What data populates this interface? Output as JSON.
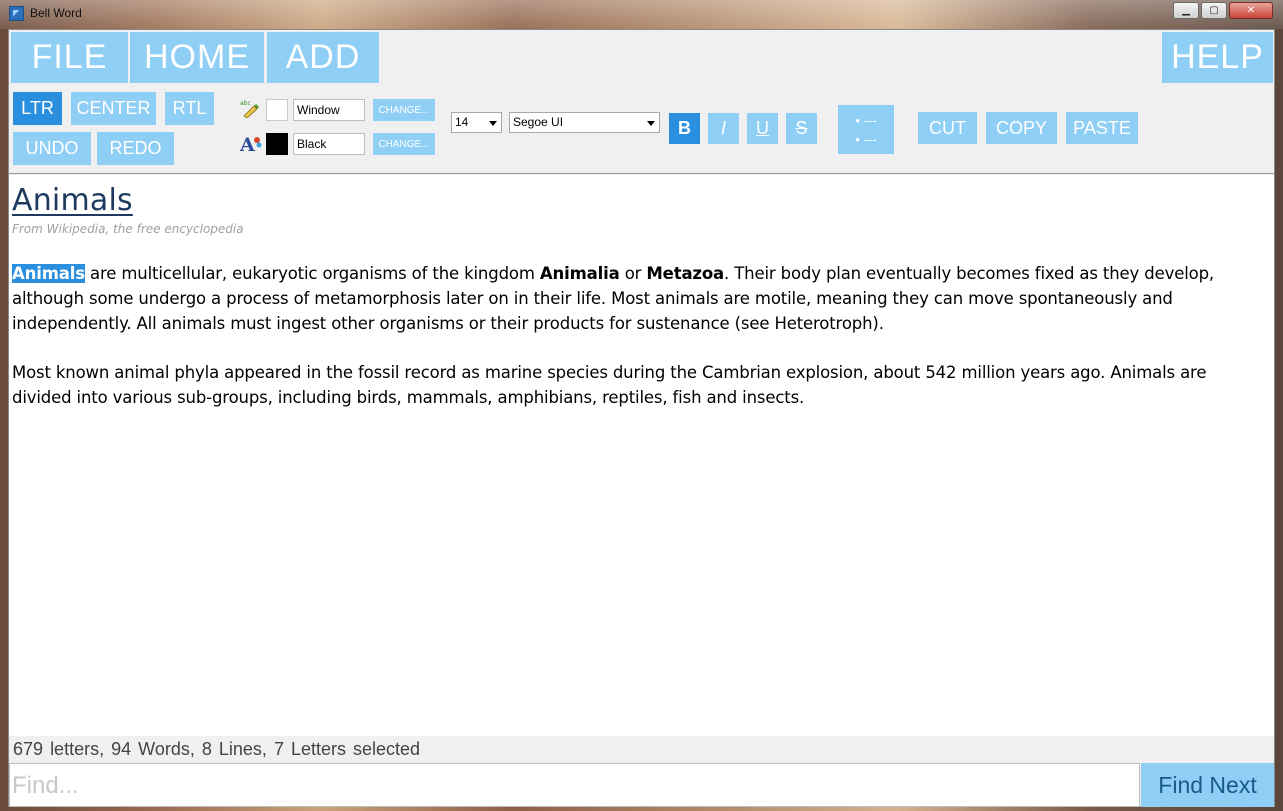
{
  "window": {
    "title": "Bell Word",
    "controls": [
      "minimize",
      "maximize",
      "close"
    ]
  },
  "tabs": {
    "file": "FILE",
    "home": "HOME",
    "add": "ADD",
    "help": "HELP"
  },
  "alignment": {
    "ltr": "LTR",
    "center": "CENTER",
    "rtl": "RTL",
    "active": "LTR"
  },
  "history": {
    "undo": "UNDO",
    "redo": "REDO"
  },
  "highlight": {
    "icon": "highlighter-icon",
    "color_name": "Window",
    "swatch_color": "#ffffff",
    "change": "CHANGE..."
  },
  "fontcolor": {
    "icon": "font-color-icon",
    "color_name": "Black",
    "swatch_color": "#000000",
    "change": "CHANGE..."
  },
  "font": {
    "size": "14",
    "family": "Segoe UI"
  },
  "format": {
    "bold": "B",
    "italic": "I",
    "underline": "U",
    "strike": "S",
    "active": "bold"
  },
  "list": {
    "item1": "• ---",
    "item2": "• ---"
  },
  "clipboard": {
    "cut": "CUT",
    "copy": "COPY",
    "paste": "PASTE"
  },
  "document": {
    "title": "Animals",
    "subtitle": "From Wikipedia, the free encyclopedia",
    "p1": {
      "selected": "Animals",
      "t1": " are multicellular, eukaryotic organisms of the kingdom ",
      "b1": "Animalia",
      "t2": " or ",
      "b2": "Metazoa",
      "t3": ". Their body plan eventually becomes fixed as they develop, although some undergo a process of metamorphosis later on in their life. Most animals are motile, meaning they can move spontaneously and independently. All animals must ingest other organisms or their products for sustenance (see Heterotroph)."
    },
    "p2": "Most known animal phyla appeared in the fossil record as marine species during the Cambrian explosion, about 542 million years ago. Animals are divided into various sub-groups, including birds, mammals, amphibians, reptiles, fish and insects."
  },
  "status": {
    "letters": "679",
    "letters_label": "letters,",
    "words": "94",
    "words_label": "Words,",
    "lines": "8",
    "lines_label": "Lines,",
    "selected": "7",
    "selected_label": "Letters selected"
  },
  "find": {
    "placeholder": "Find...",
    "button": "Find Next"
  },
  "colors": {
    "accent": "#8fcff5",
    "accent_active": "#2b8fe0",
    "title": "#1f3a5f"
  }
}
